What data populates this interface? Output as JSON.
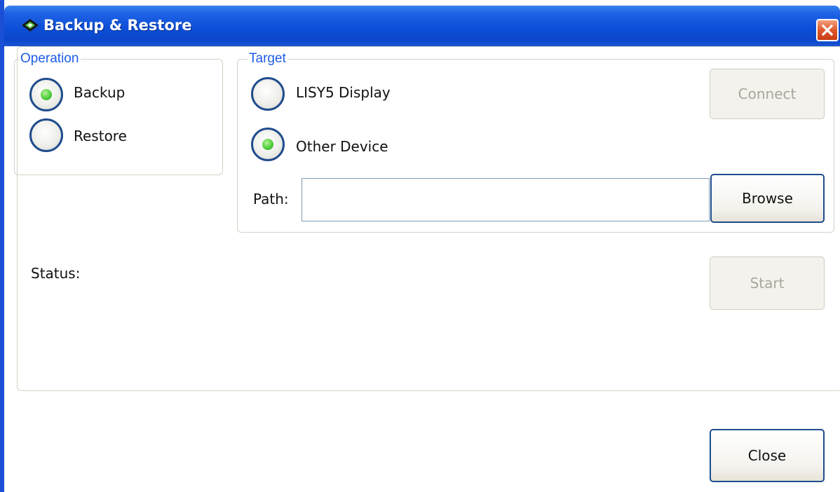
{
  "window": {
    "title": "Backup & Restore",
    "icon": "app-icon",
    "accent": "#0d4fd8",
    "close_icon": "close-icon"
  },
  "operation": {
    "label": "Operation",
    "options": [
      {
        "label": "Backup",
        "selected": true
      },
      {
        "label": "Restore",
        "selected": false
      }
    ]
  },
  "target": {
    "label": "Target",
    "options": [
      {
        "label": "LISY5 Display",
        "selected": false
      },
      {
        "label": "Other Device",
        "selected": true
      }
    ],
    "connect_label": "Connect",
    "connect_enabled": false,
    "path_label": "Path:",
    "path_value": "",
    "browse_label": "Browse"
  },
  "status": {
    "label": "Status:",
    "value": ""
  },
  "start_label": "Start",
  "start_enabled": false,
  "close_label": "Close"
}
